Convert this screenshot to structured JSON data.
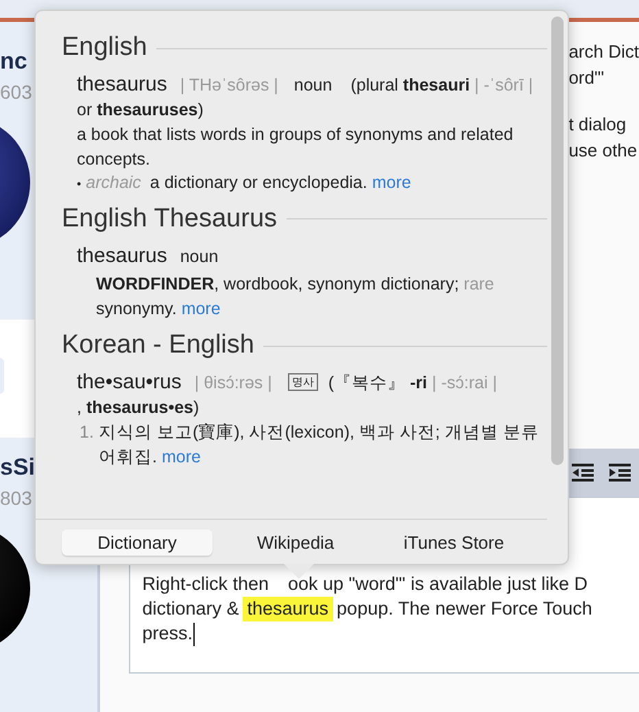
{
  "sidebar": {
    "users": [
      {
        "name": "nc",
        "number": "603"
      },
      {
        "name": "sSi",
        "number": "803"
      }
    ]
  },
  "post": {
    "lines": [
      "arch Dict",
      "ord\"'",
      "t dialog",
      "use othe"
    ]
  },
  "editor": {
    "lines": [
      [
        {
          "text": "Right-click then",
          "highlighted": false
        },
        {
          "text": "ook up \"word\"' is available just like D",
          "highlighted": false,
          "after_pointer": true
        }
      ],
      [
        {
          "text": "dictionary &",
          "highlighted": false
        },
        {
          "text": "thesaurus",
          "highlighted": true
        },
        {
          "text": "popup.  The newer Force Touch",
          "highlighted": false
        }
      ],
      [
        {
          "text": "press.",
          "highlighted": false,
          "caret": true
        }
      ]
    ]
  },
  "popover": {
    "sections": [
      {
        "heading": "English",
        "lines": [
          {
            "kind": "head",
            "parts": [
              {
                "kind": "word",
                "text": "thesaurus"
              },
              {
                "kind": "pron",
                "text": "| THəˈsôrəs |"
              },
              {
                "kind": "pos",
                "text": "noun"
              },
              {
                "kind": "plain",
                "text": "(plural **thesauri**"
              },
              {
                "kind": "pron",
                "text": "| -ˈsôrī |"
              },
              {
                "kind": "plain",
                "text": "or **thesauruses**)"
              }
            ]
          },
          {
            "kind": "def",
            "parts": [
              {
                "kind": "plain",
                "text": "a book that lists words in groups of synonyms and related concepts."
              }
            ]
          },
          {
            "kind": "def",
            "parts": [
              {
                "kind": "bullet",
                "text": "•"
              },
              {
                "kind": "italic_label",
                "text": "archaic"
              },
              {
                "kind": "plain",
                "text": "a dictionary or encyclopedia."
              },
              {
                "kind": "link",
                "text": "more"
              }
            ]
          }
        ]
      },
      {
        "heading": "English Thesaurus",
        "lines": [
          {
            "kind": "head",
            "parts": [
              {
                "kind": "word",
                "text": "thesaurus"
              },
              {
                "kind": "pos",
                "text": "noun"
              }
            ]
          },
          {
            "kind": "sub",
            "parts": [
              {
                "kind": "plain",
                "text": "**WORDFINDER**, wordbook, synonym dictionary;"
              },
              {
                "kind": "label",
                "text": "rare"
              },
              {
                "kind": "plain",
                "text": "synonymy."
              },
              {
                "kind": "link",
                "text": "more"
              }
            ]
          }
        ]
      },
      {
        "heading": "Korean - English",
        "lines": [
          {
            "kind": "head",
            "parts": [
              {
                "kind": "word",
                "text": "the•sau•rus"
              },
              {
                "kind": "pron",
                "text": "| θisɔ́:rəs |"
              },
              {
                "kind": "tag",
                "text": "명사"
              },
              {
                "kind": "plain",
                "text": "(『복수』 **-ri**"
              },
              {
                "kind": "pron",
                "text": "| -sɔ́:rai |"
              },
              {
                "kind": "plain",
                "text": ", **thesaurus•es**)"
              }
            ]
          },
          {
            "kind": "numbered",
            "number": "1.",
            "parts": [
              {
                "kind": "plain",
                "text": "지식의 보고(寶庫), 사전(lexicon), 백과 사전; 개념별 분류 어휘집."
              },
              {
                "kind": "link",
                "text": "more"
              }
            ]
          }
        ]
      }
    ],
    "tabs": [
      {
        "label": "Dictionary",
        "selected": true
      },
      {
        "label": "Wikipedia",
        "selected": false
      },
      {
        "label": "iTunes Store",
        "selected": false
      }
    ]
  }
}
